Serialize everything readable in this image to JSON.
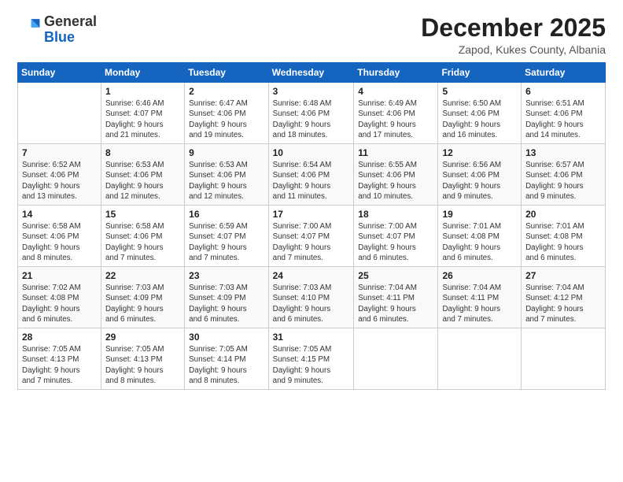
{
  "header": {
    "logo_general": "General",
    "logo_blue": "Blue",
    "month": "December 2025",
    "location": "Zapod, Kukes County, Albania"
  },
  "weekdays": [
    "Sunday",
    "Monday",
    "Tuesday",
    "Wednesday",
    "Thursday",
    "Friday",
    "Saturday"
  ],
  "weeks": [
    [
      {
        "day": "",
        "info": ""
      },
      {
        "day": "1",
        "info": "Sunrise: 6:46 AM\nSunset: 4:07 PM\nDaylight: 9 hours\nand 21 minutes."
      },
      {
        "day": "2",
        "info": "Sunrise: 6:47 AM\nSunset: 4:06 PM\nDaylight: 9 hours\nand 19 minutes."
      },
      {
        "day": "3",
        "info": "Sunrise: 6:48 AM\nSunset: 4:06 PM\nDaylight: 9 hours\nand 18 minutes."
      },
      {
        "day": "4",
        "info": "Sunrise: 6:49 AM\nSunset: 4:06 PM\nDaylight: 9 hours\nand 17 minutes."
      },
      {
        "day": "5",
        "info": "Sunrise: 6:50 AM\nSunset: 4:06 PM\nDaylight: 9 hours\nand 16 minutes."
      },
      {
        "day": "6",
        "info": "Sunrise: 6:51 AM\nSunset: 4:06 PM\nDaylight: 9 hours\nand 14 minutes."
      }
    ],
    [
      {
        "day": "7",
        "info": "Sunrise: 6:52 AM\nSunset: 4:06 PM\nDaylight: 9 hours\nand 13 minutes."
      },
      {
        "day": "8",
        "info": "Sunrise: 6:53 AM\nSunset: 4:06 PM\nDaylight: 9 hours\nand 12 minutes."
      },
      {
        "day": "9",
        "info": "Sunrise: 6:53 AM\nSunset: 4:06 PM\nDaylight: 9 hours\nand 12 minutes."
      },
      {
        "day": "10",
        "info": "Sunrise: 6:54 AM\nSunset: 4:06 PM\nDaylight: 9 hours\nand 11 minutes."
      },
      {
        "day": "11",
        "info": "Sunrise: 6:55 AM\nSunset: 4:06 PM\nDaylight: 9 hours\nand 10 minutes."
      },
      {
        "day": "12",
        "info": "Sunrise: 6:56 AM\nSunset: 4:06 PM\nDaylight: 9 hours\nand 9 minutes."
      },
      {
        "day": "13",
        "info": "Sunrise: 6:57 AM\nSunset: 4:06 PM\nDaylight: 9 hours\nand 9 minutes."
      }
    ],
    [
      {
        "day": "14",
        "info": "Sunrise: 6:58 AM\nSunset: 4:06 PM\nDaylight: 9 hours\nand 8 minutes."
      },
      {
        "day": "15",
        "info": "Sunrise: 6:58 AM\nSunset: 4:06 PM\nDaylight: 9 hours\nand 7 minutes."
      },
      {
        "day": "16",
        "info": "Sunrise: 6:59 AM\nSunset: 4:07 PM\nDaylight: 9 hours\nand 7 minutes."
      },
      {
        "day": "17",
        "info": "Sunrise: 7:00 AM\nSunset: 4:07 PM\nDaylight: 9 hours\nand 7 minutes."
      },
      {
        "day": "18",
        "info": "Sunrise: 7:00 AM\nSunset: 4:07 PM\nDaylight: 9 hours\nand 6 minutes."
      },
      {
        "day": "19",
        "info": "Sunrise: 7:01 AM\nSunset: 4:08 PM\nDaylight: 9 hours\nand 6 minutes."
      },
      {
        "day": "20",
        "info": "Sunrise: 7:01 AM\nSunset: 4:08 PM\nDaylight: 9 hours\nand 6 minutes."
      }
    ],
    [
      {
        "day": "21",
        "info": "Sunrise: 7:02 AM\nSunset: 4:08 PM\nDaylight: 9 hours\nand 6 minutes."
      },
      {
        "day": "22",
        "info": "Sunrise: 7:03 AM\nSunset: 4:09 PM\nDaylight: 9 hours\nand 6 minutes."
      },
      {
        "day": "23",
        "info": "Sunrise: 7:03 AM\nSunset: 4:09 PM\nDaylight: 9 hours\nand 6 minutes."
      },
      {
        "day": "24",
        "info": "Sunrise: 7:03 AM\nSunset: 4:10 PM\nDaylight: 9 hours\nand 6 minutes."
      },
      {
        "day": "25",
        "info": "Sunrise: 7:04 AM\nSunset: 4:11 PM\nDaylight: 9 hours\nand 6 minutes."
      },
      {
        "day": "26",
        "info": "Sunrise: 7:04 AM\nSunset: 4:11 PM\nDaylight: 9 hours\nand 7 minutes."
      },
      {
        "day": "27",
        "info": "Sunrise: 7:04 AM\nSunset: 4:12 PM\nDaylight: 9 hours\nand 7 minutes."
      }
    ],
    [
      {
        "day": "28",
        "info": "Sunrise: 7:05 AM\nSunset: 4:13 PM\nDaylight: 9 hours\nand 7 minutes."
      },
      {
        "day": "29",
        "info": "Sunrise: 7:05 AM\nSunset: 4:13 PM\nDaylight: 9 hours\nand 8 minutes."
      },
      {
        "day": "30",
        "info": "Sunrise: 7:05 AM\nSunset: 4:14 PM\nDaylight: 9 hours\nand 8 minutes."
      },
      {
        "day": "31",
        "info": "Sunrise: 7:05 AM\nSunset: 4:15 PM\nDaylight: 9 hours\nand 9 minutes."
      },
      {
        "day": "",
        "info": ""
      },
      {
        "day": "",
        "info": ""
      },
      {
        "day": "",
        "info": ""
      }
    ]
  ]
}
